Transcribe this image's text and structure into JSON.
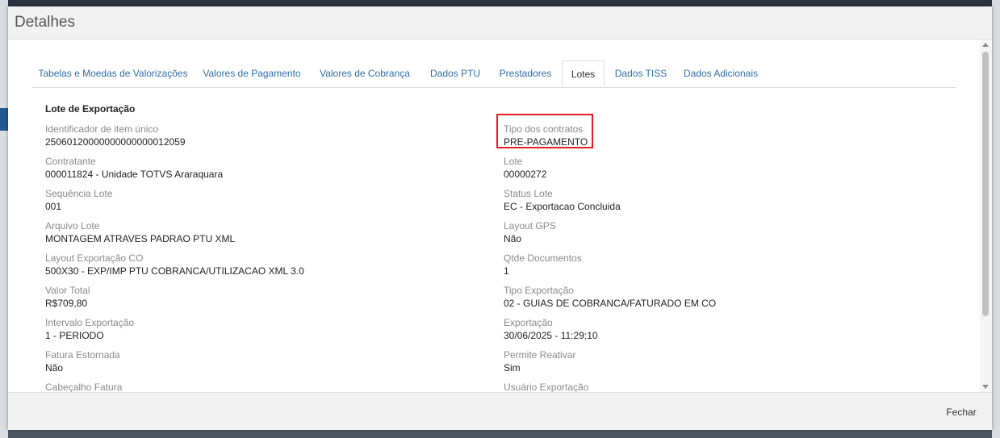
{
  "modal": {
    "title": "Detalhes",
    "close_label": "Fechar"
  },
  "tabs": [
    {
      "label": "Tabelas e Moedas de Valorizações",
      "active": false
    },
    {
      "label": "Valores de Pagamento",
      "active": false
    },
    {
      "label": "Valores de Cobrança",
      "active": false
    },
    {
      "label": "Dados PTU",
      "active": false
    },
    {
      "label": "Prestadores",
      "active": false
    },
    {
      "label": "Lotes",
      "active": true
    },
    {
      "label": "Dados TISS",
      "active": false
    },
    {
      "label": "Dados Adicionais",
      "active": false
    }
  ],
  "section": {
    "title": "Lote de Exportação"
  },
  "left_fields": [
    {
      "label": "Identificador de item único",
      "value": "25060120000000000000012059"
    },
    {
      "label": "Contratante",
      "value": "000011824 - Unidade TOTVS Araraquara"
    },
    {
      "label": "Sequência Lote",
      "value": "001"
    },
    {
      "label": "Arquivo Lote",
      "value": "MONTAGEM ATRAVES PADRAO PTU XML"
    },
    {
      "label": "Layout Exportação CO",
      "value": "500X30 - EXP/IMP PTU COBRANCA/UTILIZACAO XML 3.0"
    },
    {
      "label": "Valor Total",
      "value": "R$709,80"
    },
    {
      "label": "Intervalo Exportação",
      "value": "1 - PERIODO"
    },
    {
      "label": "Fatura Estornada",
      "value": "Não"
    },
    {
      "label": "Cabeçalho Fatura",
      "value": ""
    }
  ],
  "right_fields": [
    {
      "label": "Tipo dos contratos",
      "value": "PRE-PAGAMENTO"
    },
    {
      "label": "Lote",
      "value": "00000272"
    },
    {
      "label": "Status Lote",
      "value": "EC - Exportacao Concluida"
    },
    {
      "label": "Layout GPS",
      "value": "Não"
    },
    {
      "label": "Qtde Documentos",
      "value": "1"
    },
    {
      "label": "Tipo Exportação",
      "value": "02 - GUIAS DE COBRANCA/FATURADO EM CO"
    },
    {
      "label": "Exportação",
      "value": "30/06/2025 - 11:29:10"
    },
    {
      "label": "Permite Reativar",
      "value": "Sim"
    },
    {
      "label": "Usuário Exportação",
      "value": ""
    }
  ],
  "colors": {
    "tab_link": "#2d6ea8",
    "highlight_border": "#e31b23",
    "label": "#8a8a8a"
  }
}
